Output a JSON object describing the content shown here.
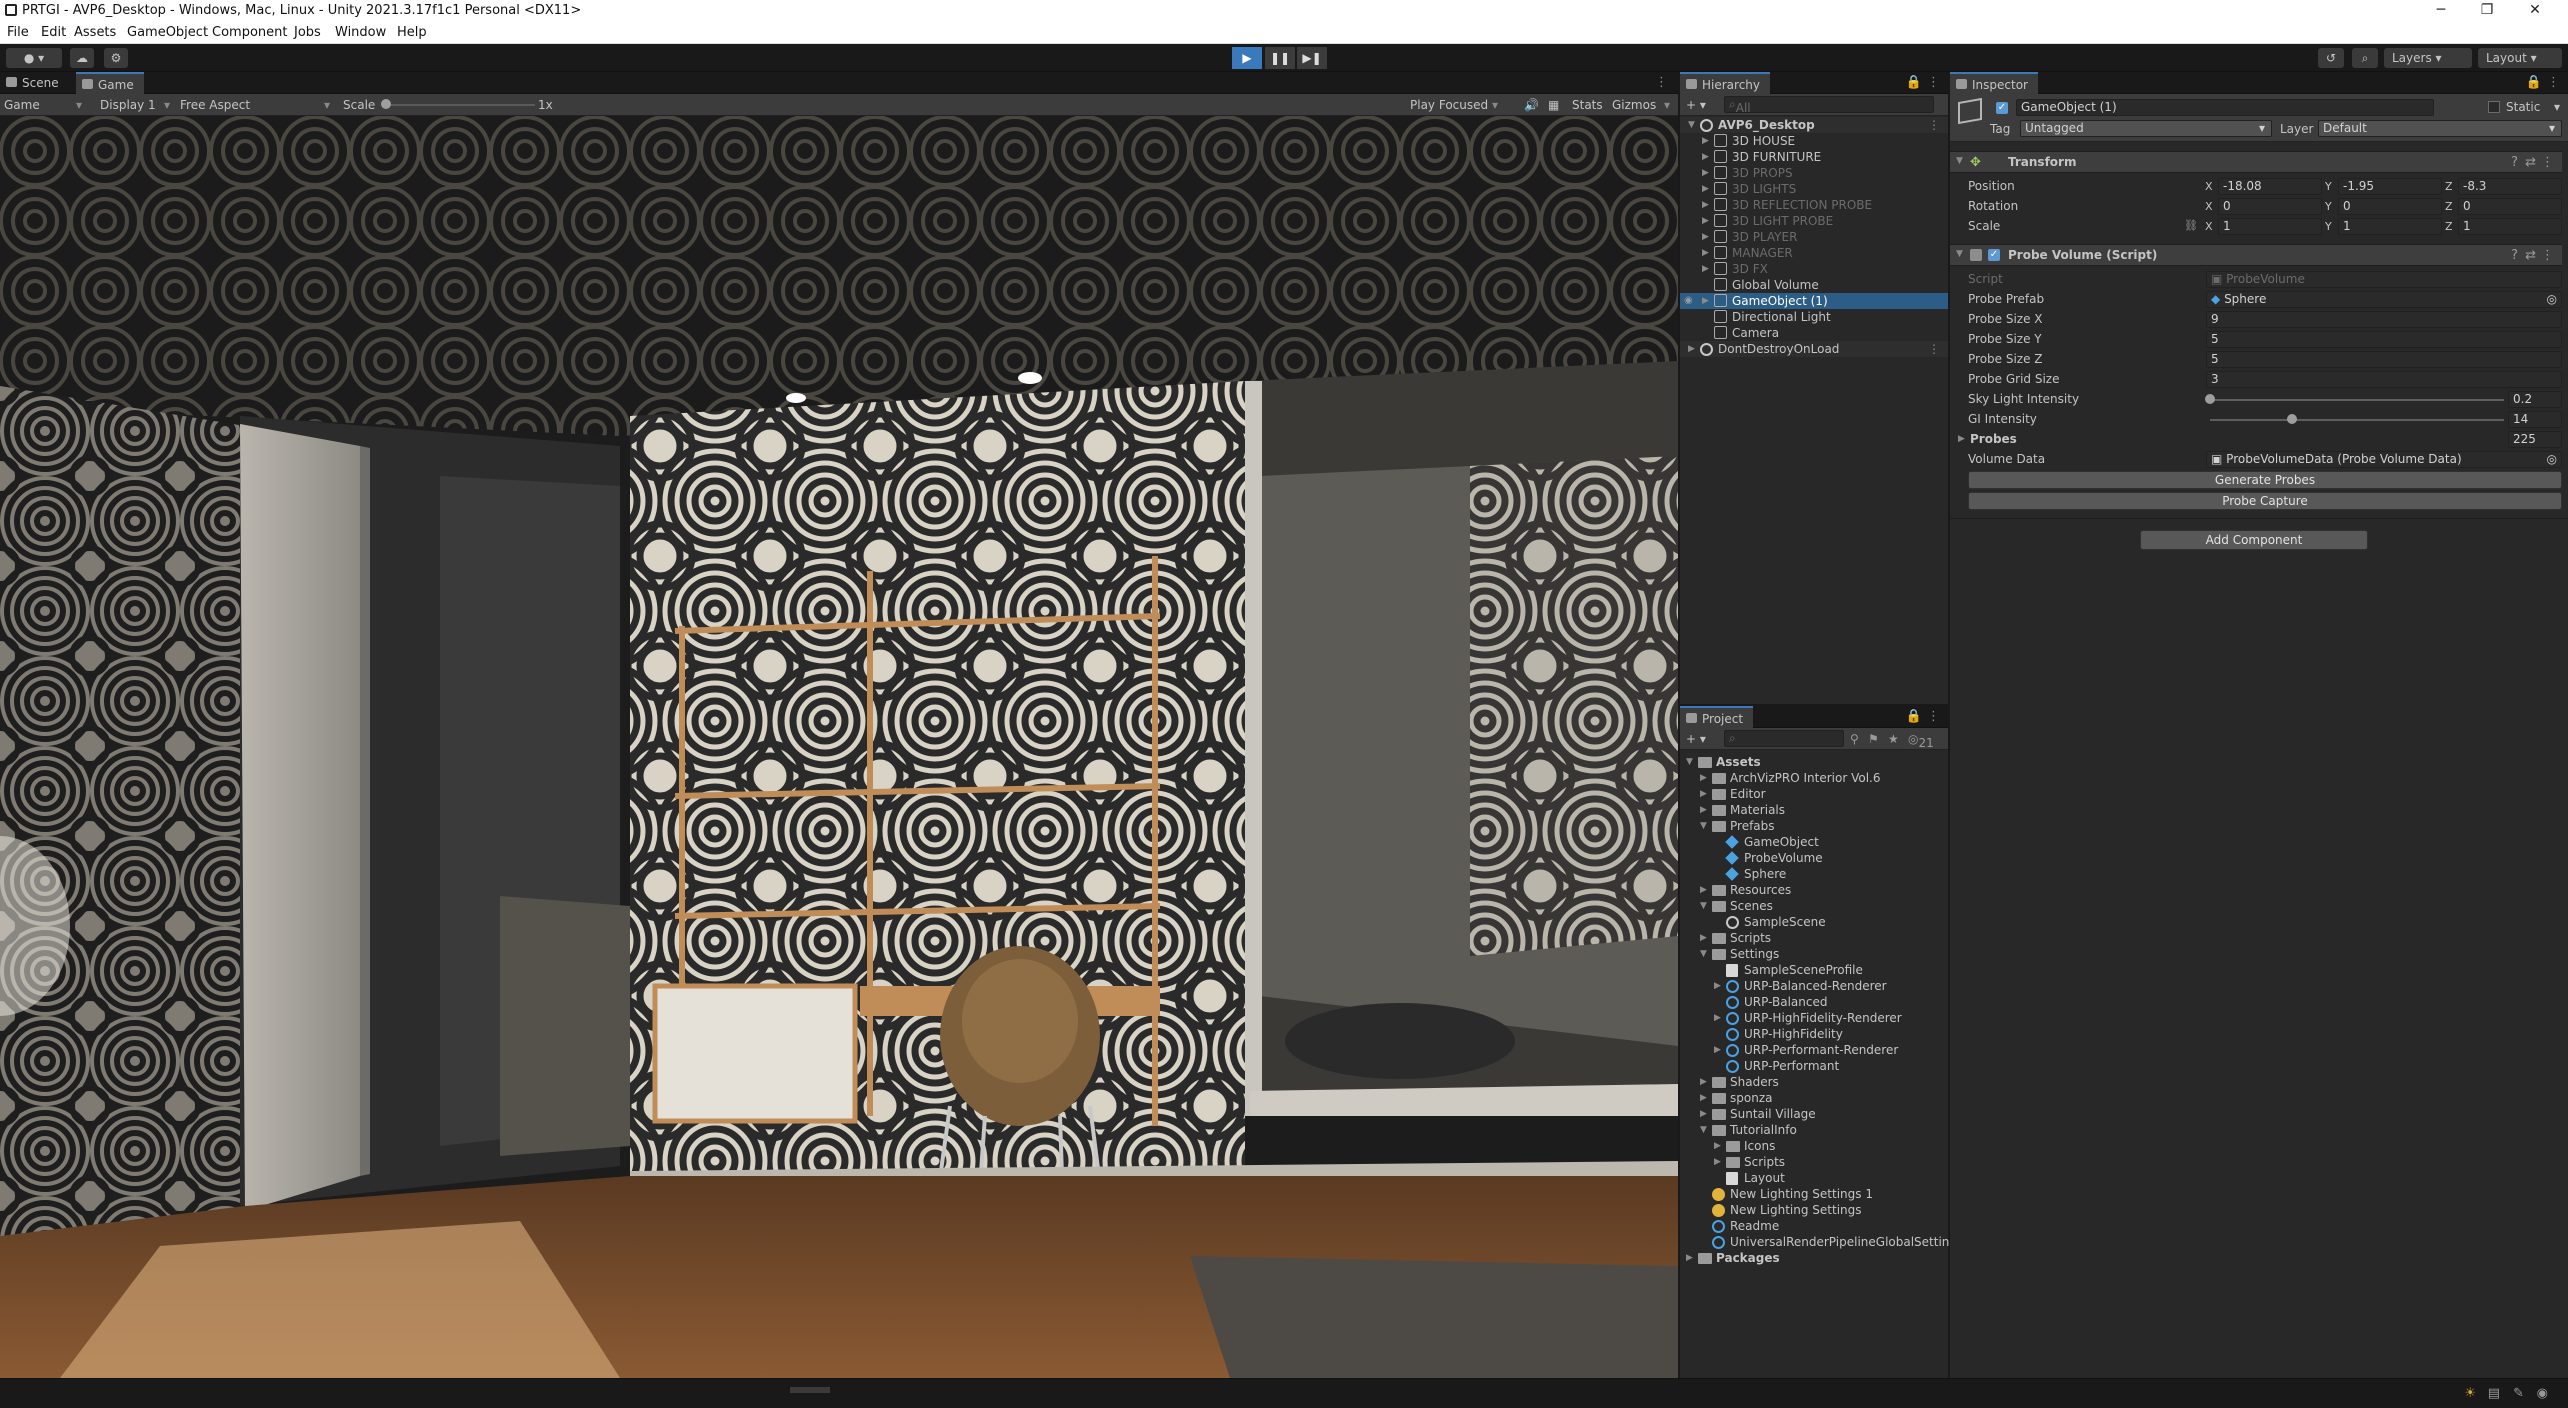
{
  "window": {
    "title": "PRTGI - AVP6_Desktop - Windows, Mac, Linux - Unity 2021.3.17f1c1 Personal <DX11>",
    "controls": [
      "─",
      "❐",
      "✕"
    ]
  },
  "menu": [
    "File",
    "Edit",
    "Assets",
    "GameObject",
    "Component",
    "Jobs",
    "Window",
    "Help"
  ],
  "toolbar": {
    "play_icon": "play-icon",
    "pause_icon": "pause-icon",
    "step_icon": "step-icon",
    "layers_label": "Layers",
    "layout_label": "Layout"
  },
  "game_panel": {
    "tabs": [
      "Scene",
      "Game"
    ],
    "active_tab": "Game",
    "view_select": "Game",
    "display_select": "Display 1",
    "aspect_select": "Free Aspect",
    "scale_label": "Scale",
    "scale_value": "1x",
    "play_mode": "Play Focused",
    "stats_label": "Stats",
    "gizmos_label": "Gizmos"
  },
  "hierarchy": {
    "tab_label": "Hierarchy",
    "search_placeholder": "All",
    "root": "AVP6_Desktop",
    "items": [
      {
        "label": "3D HOUSE",
        "dim": false
      },
      {
        "label": "3D FURNITURE",
        "dim": false
      },
      {
        "label": "3D PROPS",
        "dim": true
      },
      {
        "label": "3D LIGHTS",
        "dim": true
      },
      {
        "label": "3D REFLECTION PROBE",
        "dim": true
      },
      {
        "label": "3D LIGHT PROBE",
        "dim": true
      },
      {
        "label": "3D PLAYER",
        "dim": true
      },
      {
        "label": "MANAGER",
        "dim": true
      },
      {
        "label": "3D FX",
        "dim": true
      },
      {
        "label": "Global Volume",
        "dim": false
      },
      {
        "label": "GameObject (1)",
        "dim": false,
        "selected": true
      },
      {
        "label": "Directional Light",
        "dim": false
      },
      {
        "label": "Camera",
        "dim": false
      }
    ],
    "dont_destroy": "DontDestroyOnLoad"
  },
  "project": {
    "tab_label": "Project",
    "count_badge": "21",
    "tree": [
      {
        "label": "Assets",
        "depth": 0,
        "type": "folder",
        "bold": true
      },
      {
        "label": "ArchVizPRO Interior Vol.6",
        "depth": 1,
        "type": "folder"
      },
      {
        "label": "Editor",
        "depth": 1,
        "type": "folder"
      },
      {
        "label": "Materials",
        "depth": 1,
        "type": "folder"
      },
      {
        "label": "Prefabs",
        "depth": 1,
        "type": "folder"
      },
      {
        "label": "GameObject",
        "depth": 2,
        "type": "prefab"
      },
      {
        "label": "ProbeVolume",
        "depth": 2,
        "type": "prefab"
      },
      {
        "label": "Sphere",
        "depth": 2,
        "type": "prefab"
      },
      {
        "label": "Resources",
        "depth": 1,
        "type": "folder"
      },
      {
        "label": "Scenes",
        "depth": 1,
        "type": "folder"
      },
      {
        "label": "SampleScene",
        "depth": 2,
        "type": "scene"
      },
      {
        "label": "Scripts",
        "depth": 1,
        "type": "folder"
      },
      {
        "label": "Settings",
        "depth": 1,
        "type": "folder"
      },
      {
        "label": "SampleSceneProfile",
        "depth": 2,
        "type": "file"
      },
      {
        "label": "URP-Balanced-Renderer",
        "depth": 2,
        "type": "asset"
      },
      {
        "label": "URP-Balanced",
        "depth": 2,
        "type": "asset"
      },
      {
        "label": "URP-HighFidelity-Renderer",
        "depth": 2,
        "type": "asset"
      },
      {
        "label": "URP-HighFidelity",
        "depth": 2,
        "type": "asset"
      },
      {
        "label": "URP-Performant-Renderer",
        "depth": 2,
        "type": "asset"
      },
      {
        "label": "URP-Performant",
        "depth": 2,
        "type": "asset"
      },
      {
        "label": "Shaders",
        "depth": 1,
        "type": "folder"
      },
      {
        "label": "sponza",
        "depth": 1,
        "type": "folder"
      },
      {
        "label": "Suntail Village",
        "depth": 1,
        "type": "folder"
      },
      {
        "label": "TutorialInfo",
        "depth": 1,
        "type": "folder"
      },
      {
        "label": "Icons",
        "depth": 2,
        "type": "folder"
      },
      {
        "label": "Scripts",
        "depth": 2,
        "type": "folder"
      },
      {
        "label": "Layout",
        "depth": 2,
        "type": "file"
      },
      {
        "label": "New Lighting Settings 1",
        "depth": 1,
        "type": "lighting"
      },
      {
        "label": "New Lighting Settings",
        "depth": 1,
        "type": "lighting"
      },
      {
        "label": "Readme",
        "depth": 1,
        "type": "asset"
      },
      {
        "label": "UniversalRenderPipelineGlobalSettings",
        "depth": 1,
        "type": "asset"
      },
      {
        "label": "Packages",
        "depth": 0,
        "type": "folder",
        "bold": true
      }
    ]
  },
  "inspector": {
    "tab_label": "Inspector",
    "object_name": "GameObject (1)",
    "static_label": "Static",
    "tag_label": "Tag",
    "tag_value": "Untagged",
    "layer_label": "Layer",
    "layer_value": "Default",
    "transform": {
      "title": "Transform",
      "position_label": "Position",
      "rotation_label": "Rotation",
      "scale_label": "Scale",
      "position": {
        "x": "-18.08",
        "y": "-1.95",
        "z": "-8.3"
      },
      "rotation": {
        "x": "0",
        "y": "0",
        "z": "0"
      },
      "scale": {
        "x": "1",
        "y": "1",
        "z": "1"
      }
    },
    "probe_volume": {
      "title": "Probe Volume (Script)",
      "script_label": "Script",
      "script_value": "ProbeVolume",
      "probe_prefab_label": "Probe Prefab",
      "probe_prefab_value": "Sphere",
      "size_x_label": "Probe Size X",
      "size_x_value": "9",
      "size_y_label": "Probe Size Y",
      "size_y_value": "5",
      "size_z_label": "Probe Size Z",
      "size_z_value": "5",
      "grid_size_label": "Probe Grid Size",
      "grid_size_value": "3",
      "sky_light_label": "Sky Light Intensity",
      "sky_light_value": "0.2",
      "sky_light_fraction": 0.0,
      "gi_label": "GI Intensity",
      "gi_value": "14",
      "gi_fraction": 0.28,
      "probes_label": "Probes",
      "probes_value": "225",
      "volume_data_label": "Volume Data",
      "volume_data_value": "ProbeVolumeData (Probe Volume Data)",
      "generate_button": "Generate Probes",
      "capture_button": "Probe Capture"
    },
    "add_component_button": "Add Component"
  },
  "axes": {
    "x": "X",
    "y": "Y",
    "z": "Z"
  },
  "colors": {
    "selection": "#2c5d87",
    "accent": "#3a79bb",
    "panel": "#282828",
    "header": "#3c3c3c"
  }
}
